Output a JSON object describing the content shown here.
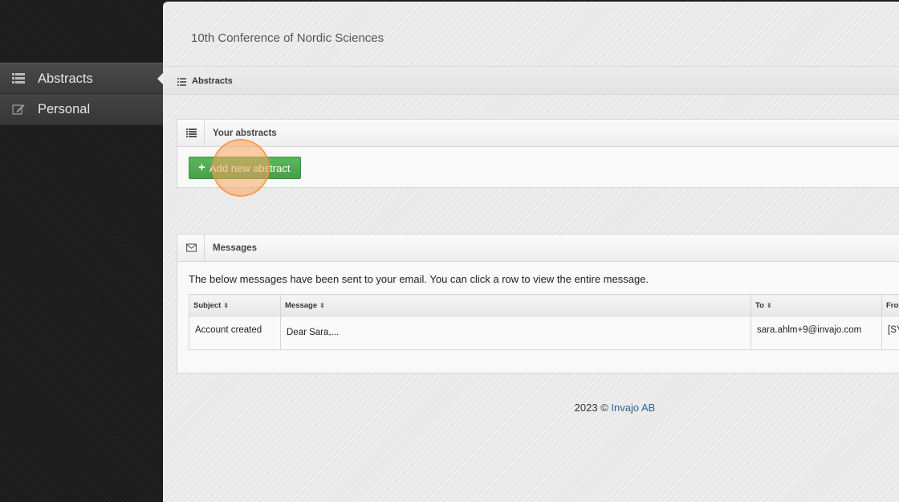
{
  "sidebar": {
    "items": [
      {
        "label": "Abstracts",
        "icon": "list-icon",
        "active": true
      },
      {
        "label": "Personal",
        "icon": "edit-icon",
        "active": false
      }
    ]
  },
  "header": {
    "title": "10th Conference of Nordic Sciences"
  },
  "breadcrumb": {
    "label": "Abstracts",
    "icon": "list-icon"
  },
  "abstracts_panel": {
    "title": "Your abstracts",
    "add_button": {
      "icon": "plus-icon",
      "label": "Add new abstract"
    }
  },
  "messages_panel": {
    "title": "Messages",
    "intro": "The below messages have been sent to your email. You can click a row to view the entire message.",
    "columns": [
      "Subject",
      "Message",
      "To",
      "Fron"
    ],
    "rows": [
      {
        "subject": "Account created",
        "message": "Dear Sara,...",
        "to": "sara.ahlm+9@invajo.com",
        "from": "[SY"
      }
    ]
  },
  "footer": {
    "year_text": "2023 ©",
    "link_label": "Invajo AB"
  },
  "colors": {
    "accent_green": "#5cb85c",
    "link_blue": "#2a6496",
    "click_marker": "#f5a05a"
  }
}
